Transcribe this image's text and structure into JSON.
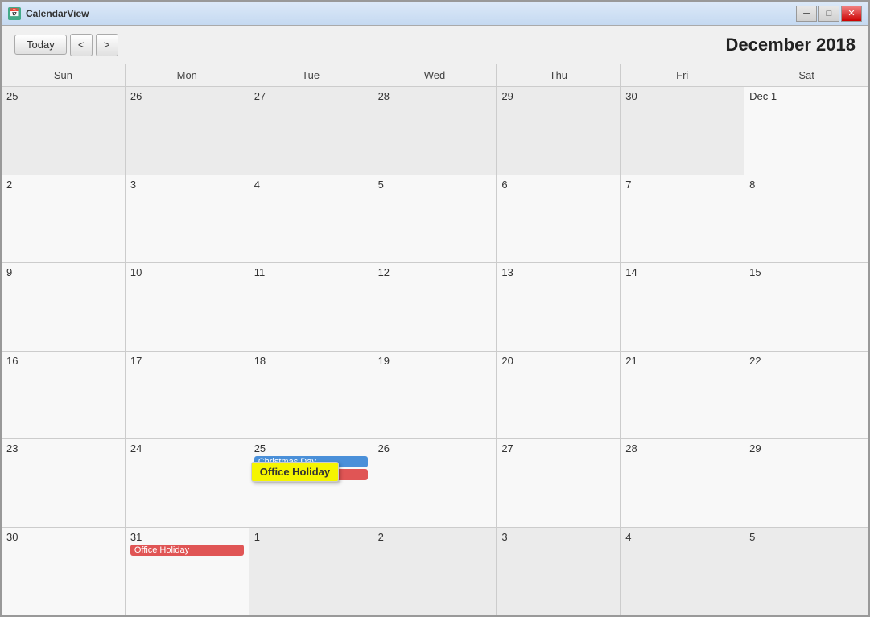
{
  "window": {
    "title": "CalendarView",
    "minimize_label": "─",
    "restore_label": "□",
    "close_label": "✕"
  },
  "toolbar": {
    "today_label": "Today",
    "prev_label": "<",
    "next_label": ">",
    "month_title": "December 2018"
  },
  "day_headers": [
    "Sun",
    "Mon",
    "Tue",
    "Wed",
    "Thu",
    "Fri",
    "Sat"
  ],
  "cells": [
    {
      "date": "25",
      "other": true,
      "events": []
    },
    {
      "date": "26",
      "other": true,
      "events": []
    },
    {
      "date": "27",
      "other": true,
      "events": []
    },
    {
      "date": "28",
      "other": true,
      "events": []
    },
    {
      "date": "29",
      "other": true,
      "events": []
    },
    {
      "date": "30",
      "other": true,
      "events": []
    },
    {
      "date": "Dec 1",
      "other": false,
      "events": []
    },
    {
      "date": "2",
      "other": false,
      "events": []
    },
    {
      "date": "3",
      "other": false,
      "events": []
    },
    {
      "date": "4",
      "other": false,
      "events": []
    },
    {
      "date": "5",
      "other": false,
      "events": []
    },
    {
      "date": "6",
      "other": false,
      "events": []
    },
    {
      "date": "7",
      "other": false,
      "events": []
    },
    {
      "date": "8",
      "other": false,
      "events": []
    },
    {
      "date": "9",
      "other": false,
      "events": []
    },
    {
      "date": "10",
      "other": false,
      "events": []
    },
    {
      "date": "11",
      "other": false,
      "events": []
    },
    {
      "date": "12",
      "other": false,
      "events": []
    },
    {
      "date": "13",
      "other": false,
      "events": []
    },
    {
      "date": "14",
      "other": false,
      "events": []
    },
    {
      "date": "15",
      "other": false,
      "events": []
    },
    {
      "date": "16",
      "other": false,
      "events": []
    },
    {
      "date": "17",
      "other": false,
      "events": []
    },
    {
      "date": "18",
      "other": false,
      "events": []
    },
    {
      "date": "19",
      "other": false,
      "events": []
    },
    {
      "date": "20",
      "other": false,
      "events": []
    },
    {
      "date": "21",
      "other": false,
      "events": []
    },
    {
      "date": "22",
      "other": false,
      "events": []
    },
    {
      "date": "23",
      "other": false,
      "events": []
    },
    {
      "date": "24",
      "other": false,
      "events": []
    },
    {
      "date": "25",
      "other": false,
      "events": [
        {
          "type": "blue",
          "label": "Christmas Day"
        },
        {
          "type": "red",
          "label": "Christmas Day"
        },
        {
          "type": "yellow",
          "label": "Office Holiday"
        }
      ]
    },
    {
      "date": "26",
      "other": false,
      "events": []
    },
    {
      "date": "27",
      "other": false,
      "events": []
    },
    {
      "date": "28",
      "other": false,
      "events": []
    },
    {
      "date": "29",
      "other": false,
      "events": []
    },
    {
      "date": "30",
      "other": false,
      "events": []
    },
    {
      "date": "31",
      "other": false,
      "events": [
        {
          "type": "red",
          "label": "Office Holiday"
        }
      ]
    },
    {
      "date": "1",
      "other": true,
      "events": []
    },
    {
      "date": "2",
      "other": true,
      "events": []
    },
    {
      "date": "3",
      "other": true,
      "events": []
    },
    {
      "date": "4",
      "other": true,
      "events": []
    },
    {
      "date": "5",
      "other": true,
      "events": []
    }
  ]
}
